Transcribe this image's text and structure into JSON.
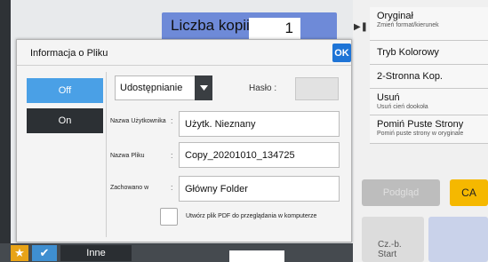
{
  "copies": {
    "label": "Liczba kopii",
    "value": "1"
  },
  "right_panel": [
    {
      "main": "Oryginał",
      "sub": "Zmień format/kierunek"
    },
    {
      "main": "Tryb Kolorowy",
      "sub": ""
    },
    {
      "main": "2-Stronna Kop.",
      "sub": ""
    },
    {
      "main": "Usuń",
      "sub": "Usuń cień dookoła"
    },
    {
      "main": "Pomiń Puste Strony",
      "sub": "Pomiń puste strony w oryginale"
    }
  ],
  "actions": {
    "preview": "Podgląd",
    "ca": "CA",
    "start_line1": "Cz.-b.",
    "start_line2": "Start"
  },
  "bottom": {
    "other": "Inne"
  },
  "dialog": {
    "title": "Informacja o Pliku",
    "ok": "OK",
    "off": "Off",
    "on": "On",
    "mode_value": "Udostępnianie",
    "password_label": "Hasło :",
    "fields": [
      {
        "label": "Nazwa Użytkownika",
        "value": "Użytk. Nieznany"
      },
      {
        "label": "Nazwa Pliku",
        "value": "Copy_20201010_134725"
      },
      {
        "label": "Zachowano w",
        "value": "Główny Folder"
      }
    ],
    "pdf_label": "Utwórz plik PDF do przeglądania w komputerze"
  },
  "colors": {
    "accent": "#1e74d6",
    "selected": "#4aa0e6",
    "ca": "#f5b800",
    "copies_bar": "#6e8ad8"
  }
}
